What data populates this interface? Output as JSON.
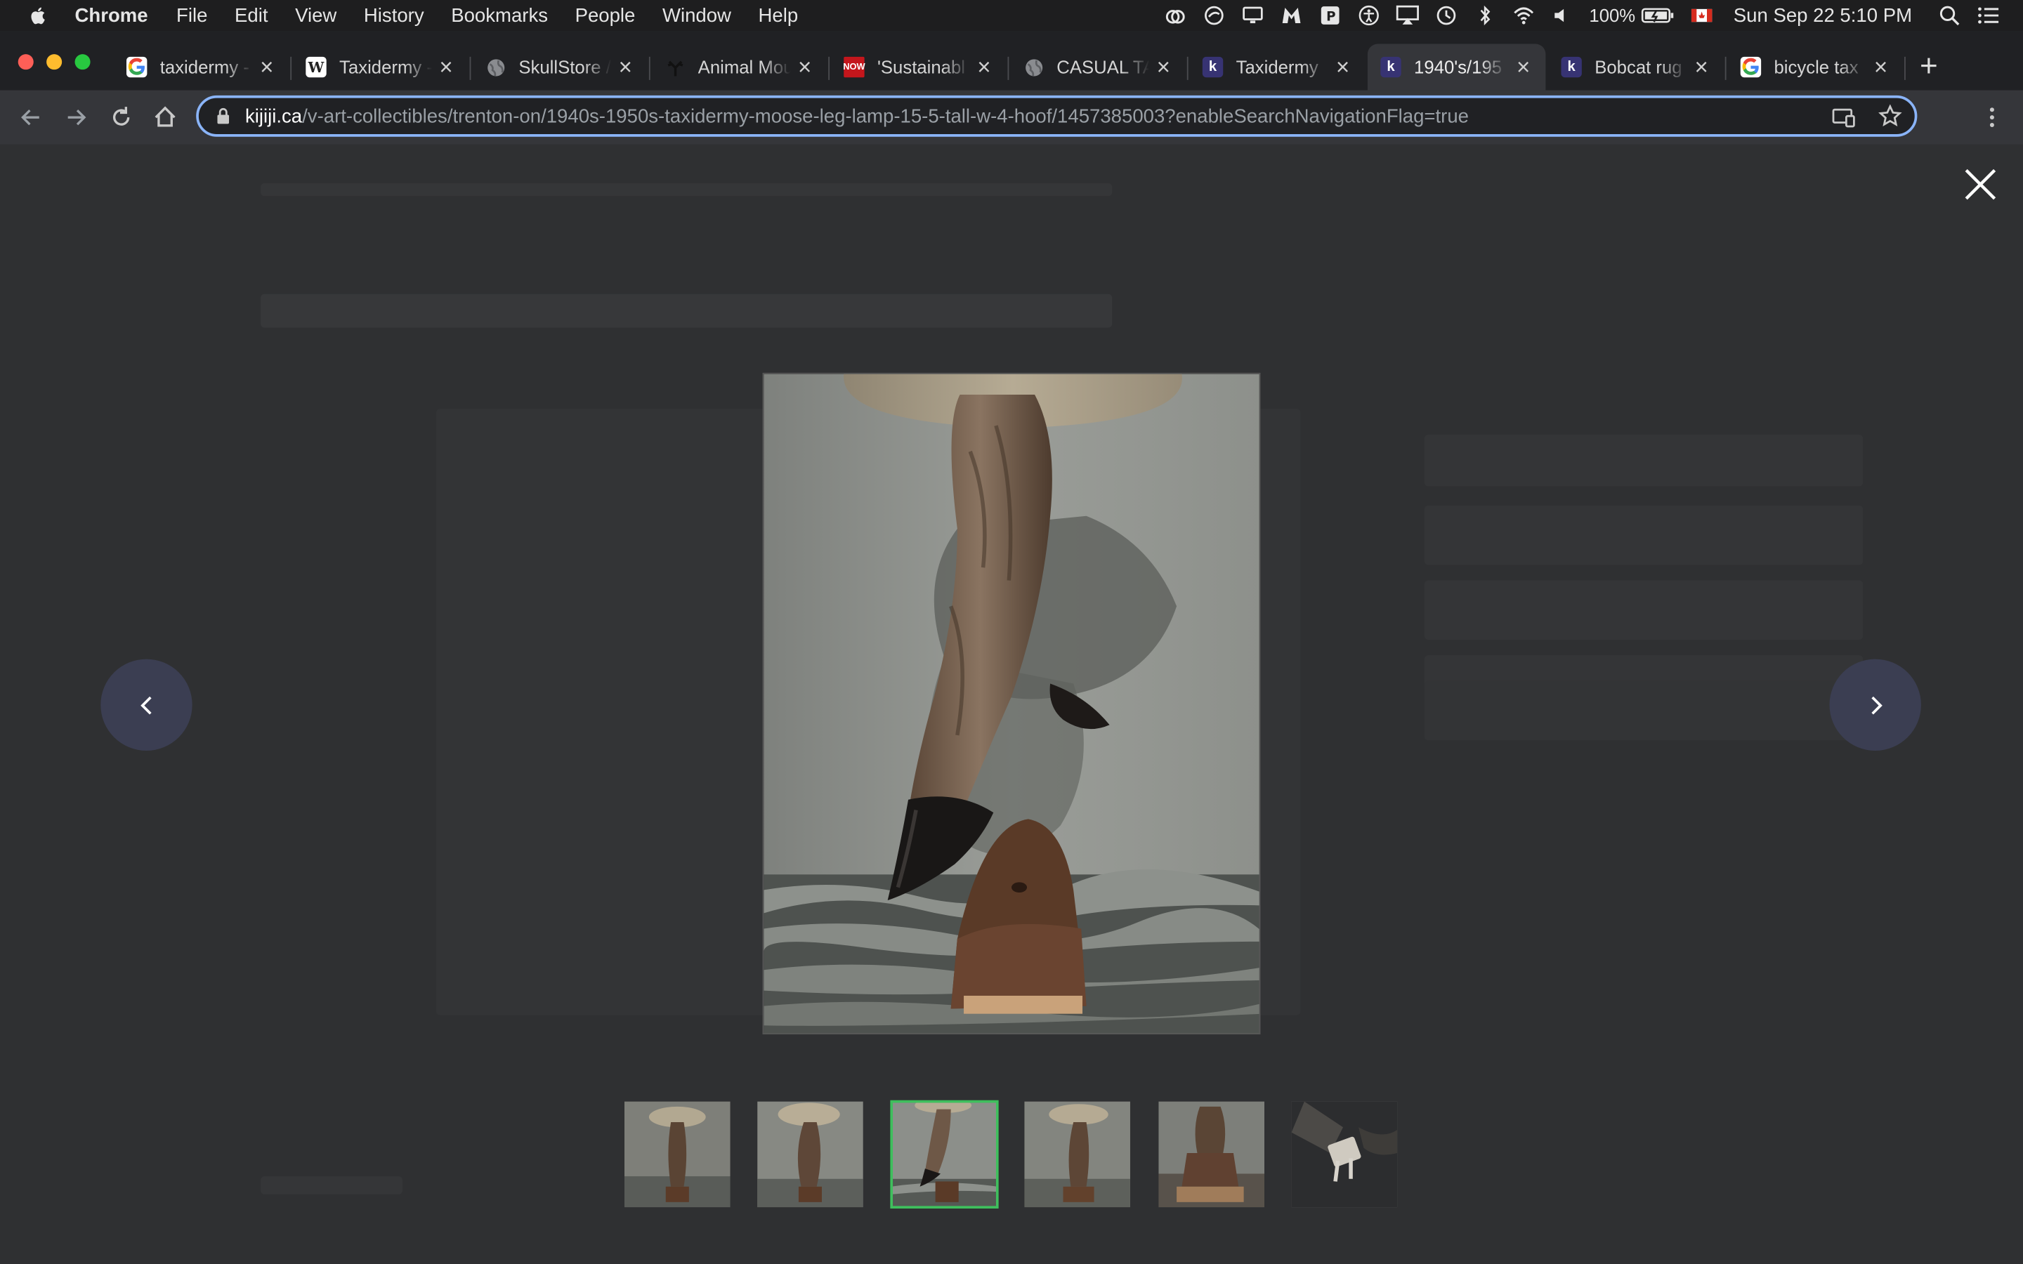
{
  "menubar": {
    "app_name": "Chrome",
    "items": [
      "File",
      "Edit",
      "View",
      "History",
      "Bookmarks",
      "People",
      "Window",
      "Help"
    ],
    "battery": "100%",
    "clock": "Sun Sep 22  5:10 PM"
  },
  "tabs": [
    {
      "title": "taxidermy -",
      "favicon": "google-icon"
    },
    {
      "title": "Taxidermy -",
      "favicon": "wikipedia-icon"
    },
    {
      "title": "SkullStore /",
      "favicon": "globe-icon"
    },
    {
      "title": "Animal Mou",
      "favicon": "antler-icon"
    },
    {
      "title": "'Sustainabl",
      "favicon": "news-icon"
    },
    {
      "title": "CASUAL TA",
      "favicon": "globe-icon"
    },
    {
      "title": "Taxidermy",
      "favicon": "kijiji-icon"
    },
    {
      "title": "1940's/195",
      "favicon": "kijiji-icon",
      "active": true
    },
    {
      "title": "Bobcat rug",
      "favicon": "kijiji-icon"
    },
    {
      "title": "bicycle tax",
      "favicon": "google-icon"
    }
  ],
  "address_bar": {
    "host": "kijiji.ca",
    "path": "/v-art-collectibles/trenton-on/1940s-1950s-taxidermy-moose-leg-lamp-15-5-tall-w-4-hoof/1457385003?enableSearchNavigationFlag=true"
  },
  "gallery": {
    "selected_index": 2,
    "thumbnail_count": 6
  },
  "colors": {
    "selected_outline": "#3fbf5d",
    "nav_button": "#3b3e52",
    "omnibox_focus": "#8ab4f8"
  }
}
